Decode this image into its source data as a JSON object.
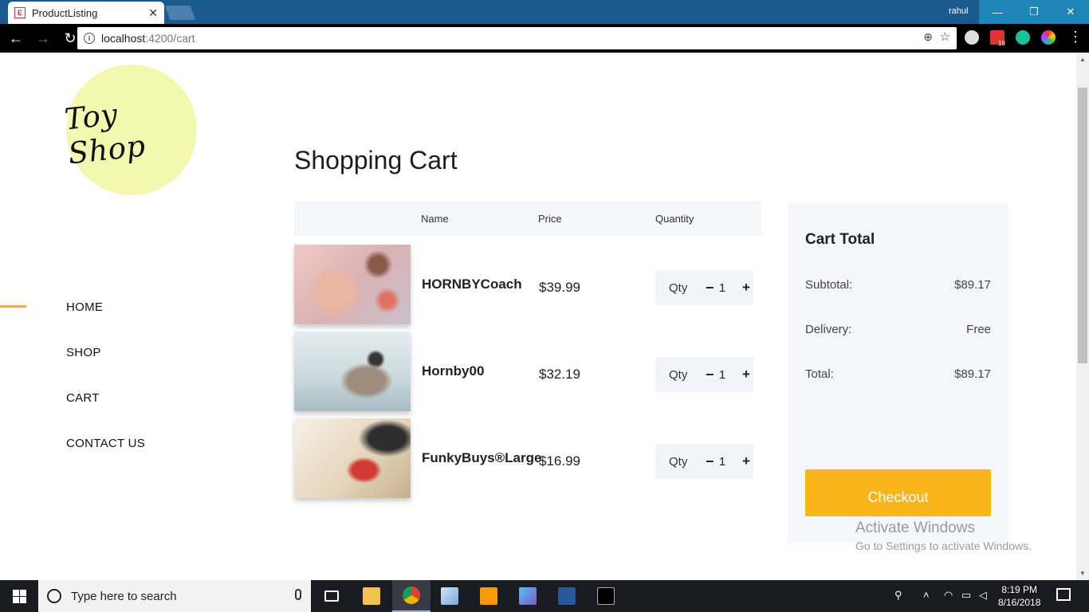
{
  "browser": {
    "tab_title": "ProductListing",
    "favicon_letter": "E",
    "user": "rahul",
    "url_host": "localhost",
    "url_path": ":4200/cart"
  },
  "window_controls": {
    "minimize": "—",
    "restore": "❐",
    "close": "✕"
  },
  "extensions": {
    "badge_count": "18"
  },
  "site": {
    "logo_text": "Toy Shop",
    "nav": [
      {
        "label": "HOME",
        "active": true
      },
      {
        "label": "SHOP"
      },
      {
        "label": "CART"
      },
      {
        "label": "CONTACT US"
      }
    ],
    "accent_color": "#f9b51a"
  },
  "cart": {
    "title": "Shopping Cart",
    "columns": {
      "name": "Name",
      "price": "Price",
      "quantity": "Quantity"
    },
    "qty_label": "Qty",
    "minus": "−",
    "plus": "+",
    "items": [
      {
        "name": "HORNBYCoach",
        "price": "$39.99",
        "qty": "1"
      },
      {
        "name": "Hornby00",
        "price": "$32.19",
        "qty": "1"
      },
      {
        "name": "FunkyBuys®Large",
        "price": "$16.99",
        "qty": "1"
      }
    ]
  },
  "totals": {
    "title": "Cart Total",
    "subtotal_label": "Subtotal:",
    "subtotal_value": "$89.17",
    "delivery_label": "Delivery:",
    "delivery_value": "Free",
    "total_label": "Total:",
    "total_value": "$89.17",
    "checkout_label": "Checkout"
  },
  "watermark": {
    "line1": "Activate Windows",
    "line2": "Go to Settings to activate Windows."
  },
  "taskbar": {
    "search_placeholder": "Type here to search",
    "time": "8:19 PM",
    "date": "8/16/2018"
  }
}
